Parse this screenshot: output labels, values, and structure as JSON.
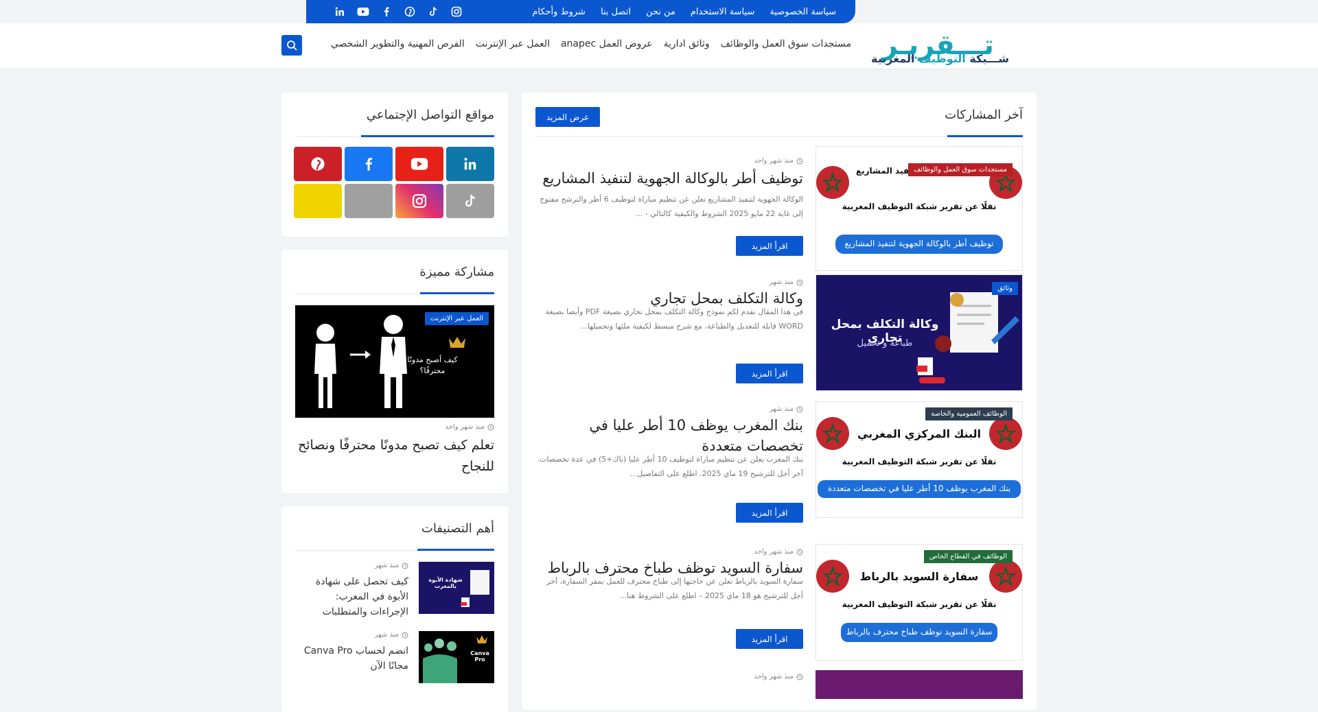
{
  "topbar": {
    "links": [
      "سياسة الخصوصية",
      "سياسة الاستخدام",
      "من نحن",
      "اتصل بنا",
      "شروط وأحكام"
    ],
    "social_icons": [
      "linkedin-icon",
      "youtube-icon",
      "facebook-icon",
      "pinterest-icon",
      "tiktok-icon",
      "instagram-icon"
    ]
  },
  "logo": {
    "line1": "تـــقريـر",
    "line2_a": "شـــبكة ",
    "line2_b": "التوظيف",
    "line2_c": " المغربية"
  },
  "nav": {
    "items": [
      "مستجدات سوق العمل والوظائف",
      "وثائق ادارية",
      "عروض العمل anapec",
      "العمل عبر الإنترنت",
      "الفرص المهنية والتطوير الشخصي"
    ],
    "search_icon": "search-icon"
  },
  "main": {
    "section_title": "آخر المشاركات",
    "more_button": "عرض المزيد",
    "read_more": "اقرأ المزيد",
    "posts": [
      {
        "category": "مستجدات سوق العمل والوظائف",
        "meta": "منذ شهر واحد",
        "title": "توظيف أطر بالوكالة الجهوية لتنفيذ المشاريع",
        "excerpt": "الوكالة الجهوية لتنفيذ المشاريع تعلن عن تنظيم مباراة لتوظيف 6 أطر والترشح مفتوح إلى غاية 22 مايو 2025 الشروط والكيفية كالتالي - ...",
        "image_heading": "الوكالة الجهوية لتنفيذ المشاريع",
        "image_small": "نقلًا عن تقرير شبكة التوظيف المغربية",
        "image_pill": "توظيف أطر بالوكالة الجهوية لتنفيذ المشاريع"
      },
      {
        "category": "وثائق",
        "meta": "منذ شهر",
        "title": "وكالة التكلف بمحل تجاري",
        "excerpt": "في هذا المقال نقدم لكم نموذج وكالة التكلف بمحل تجاري بصيغة PDF وأيضا بصيغة WORD قابلة للتعديل والطباعة، مع شرح مبسط لكيفية ملئها وتحميلها...",
        "image_heading": "وكالة التكلف بمحل تجاري",
        "image_sub": "طباعة و تحميل"
      },
      {
        "category": "الوظائف العمومية والخاصة",
        "meta": "منذ شهر",
        "title": "بنك المغرب يوظف 10 أطر عليا في تخصصات متعددة",
        "excerpt": "بنك المغرب يعلن عن تنظيم مباراة لتوظيف 10 أطر عليا (باك+5) في عدة تخصصات. آخر أجل للترشيح 19 ماي 2025. اطلع على التفاصيل...",
        "image_heading": "البنك المركزي المغربي",
        "image_small": "نقلًا عن تقرير شبكة التوظيف المغربية",
        "image_pill": "بنك المغرب يوظف 10 أطر عليا في تخصصات متعددة"
      },
      {
        "category": "الوظائف في القطاع الخاص",
        "meta": "منذ شهر واحد",
        "title": "سفارة السويد توظف طباخ محترف بالرباط",
        "excerpt": "سفارة السويد بالرباط تعلن عن حاجتها إلى طباخ محترف للعمل بمقر السفارة، آخر أجل للترشيح هو 18 ماي 2025 – اطلع على الشروط هنا...",
        "image_heading": "سفارة السويد بالرباط",
        "image_small": "نقلًا عن تقرير شبكة التوظيف المغربية",
        "image_pill": "سفارة السويد توظف طباخ محترف بالرباط"
      },
      {
        "meta": "منذ شهر واحد"
      }
    ]
  },
  "sidebar": {
    "social": {
      "title": "مواقع التواصل الإجتماعي",
      "tiles": [
        {
          "icon": "linkedin-icon",
          "color": "#0e76a8"
        },
        {
          "icon": "youtube-icon",
          "color": "#e62117"
        },
        {
          "icon": "facebook-icon",
          "color": "#1877f2"
        },
        {
          "icon": "pinterest-icon",
          "color": "#cb2027"
        },
        {
          "icon": "tiktok-icon",
          "color": "#9e9e9e"
        },
        {
          "icon": "instagram-icon",
          "color": "#d6249f"
        },
        {
          "icon": "grey-icon",
          "color": "#a0a0a0"
        },
        {
          "icon": "yellow-icon",
          "color": "#f0d400"
        }
      ]
    },
    "featured": {
      "title": "مشاركة مميزة",
      "badge": "العمل عبر الإنترنت",
      "meta": "منذ شهر واحد",
      "post_title": "تعلم كيف تصبح مدونًا محترفًا ونصائح للنجاح",
      "image_text": "كيف أصبح مدونًا محترفًا؟"
    },
    "categories": {
      "title": "أهم التصنيفات",
      "items": [
        {
          "meta": "منذ شهر",
          "title": "كيف تحصل على شهادة الأبوة في المغرب: الإجراءات والمتطلبات",
          "img_text": "شهادة الأبوة بالمغرب"
        },
        {
          "meta": "منذ شهر",
          "title": "انضم لحساب Canva Pro مجانًا الآن",
          "img_text": "Canva Pro"
        }
      ]
    }
  }
}
